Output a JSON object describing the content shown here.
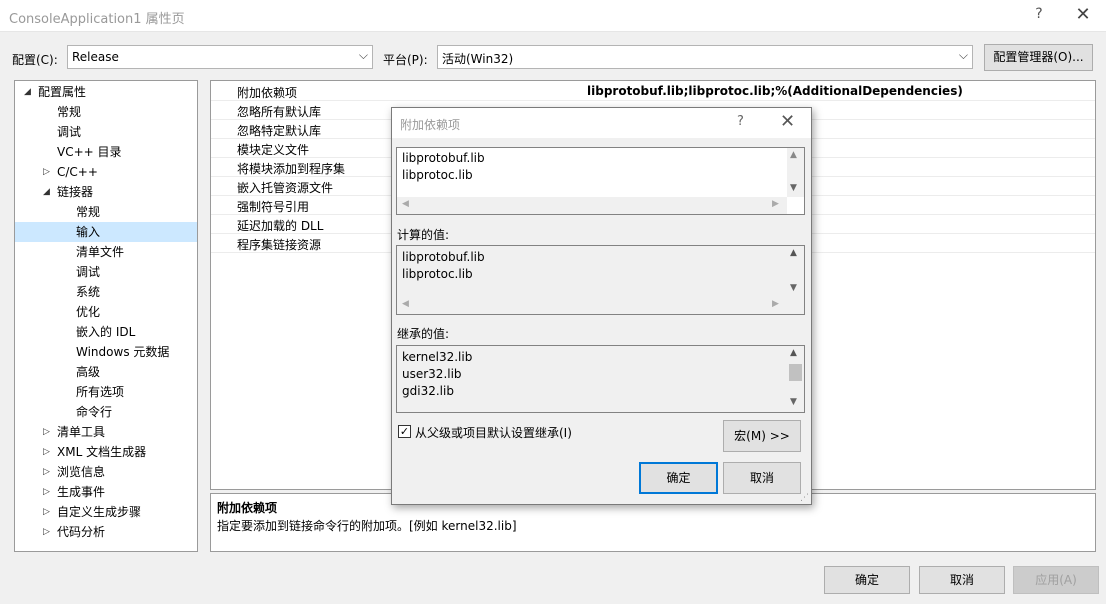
{
  "window": {
    "title": "ConsoleApplication1 属性页",
    "help_label": "?",
    "close_label": "✕"
  },
  "toolbar": {
    "config_label": "配置(C):",
    "config_value": "Release",
    "platform_label": "平台(P):",
    "platform_value": "活动(Win32)",
    "config_manager_label": "配置管理器(O)...",
    "dropdown_glyph": "⌵"
  },
  "tree": {
    "items": [
      {
        "label": "配置属性",
        "arrow": "◢"
      },
      {
        "label": "常规",
        "arrow": ""
      },
      {
        "label": "调试",
        "arrow": ""
      },
      {
        "label": "VC++ 目录",
        "arrow": ""
      },
      {
        "label": "C/C++",
        "arrow": "▷"
      },
      {
        "label": "链接器",
        "arrow": "◢"
      },
      {
        "label": "常规",
        "arrow": ""
      },
      {
        "label": "输入",
        "arrow": ""
      },
      {
        "label": "清单文件",
        "arrow": ""
      },
      {
        "label": "调试",
        "arrow": ""
      },
      {
        "label": "系统",
        "arrow": ""
      },
      {
        "label": "优化",
        "arrow": ""
      },
      {
        "label": "嵌入的 IDL",
        "arrow": ""
      },
      {
        "label": "Windows 元数据",
        "arrow": ""
      },
      {
        "label": "高级",
        "arrow": ""
      },
      {
        "label": "所有选项",
        "arrow": ""
      },
      {
        "label": "命令行",
        "arrow": ""
      },
      {
        "label": "清单工具",
        "arrow": "▷"
      },
      {
        "label": "XML 文档生成器",
        "arrow": "▷"
      },
      {
        "label": "浏览信息",
        "arrow": "▷"
      },
      {
        "label": "生成事件",
        "arrow": "▷"
      },
      {
        "label": "自定义生成步骤",
        "arrow": "▷"
      },
      {
        "label": "代码分析",
        "arrow": "▷"
      }
    ]
  },
  "grid": {
    "rows": [
      {
        "name": "附加依赖项",
        "value": "libprotobuf.lib;libprotoc.lib;%(AdditionalDependencies)"
      },
      {
        "name": "忽略所有默认库",
        "value": ""
      },
      {
        "name": "忽略特定默认库",
        "value": ""
      },
      {
        "name": "模块定义文件",
        "value": ""
      },
      {
        "name": "将模块添加到程序集",
        "value": ""
      },
      {
        "name": "嵌入托管资源文件",
        "value": ""
      },
      {
        "name": "强制符号引用",
        "value": ""
      },
      {
        "name": "延迟加载的 DLL",
        "value": ""
      },
      {
        "name": "程序集链接资源",
        "value": ""
      }
    ]
  },
  "description": {
    "title": "附加依赖项",
    "text": "指定要添加到链接命令行的附加项。[例如 kernel32.lib]"
  },
  "dialog": {
    "title": "附加依赖项",
    "help_label": "?",
    "close_label": "✕",
    "edit_lines": [
      "libprotobuf.lib",
      "libprotoc.lib"
    ],
    "evaluated_label": "计算的值:",
    "evaluated_lines": [
      "libprotobuf.lib",
      "libprotoc.lib"
    ],
    "inherited_label": "继承的值:",
    "inherited_lines": [
      "kernel32.lib",
      "user32.lib",
      "gdi32.lib"
    ],
    "inherit_checkbox_label": "从父级或项目默认设置继承(I)",
    "inherit_checked": true,
    "check_glyph": "✓",
    "macro_button": "宏(M) >>",
    "ok_button": "确定",
    "cancel_button": "取消",
    "scroll_up": "▲",
    "scroll_down": "▼",
    "scroll_left": "◀",
    "scroll_right": "▶",
    "grip": "⋰"
  },
  "footer": {
    "ok_button": "确定",
    "cancel_button": "取消",
    "apply_button": "应用(A)"
  },
  "colors": {
    "selection": "#cce8ff",
    "primary_border": "#0078d7"
  }
}
